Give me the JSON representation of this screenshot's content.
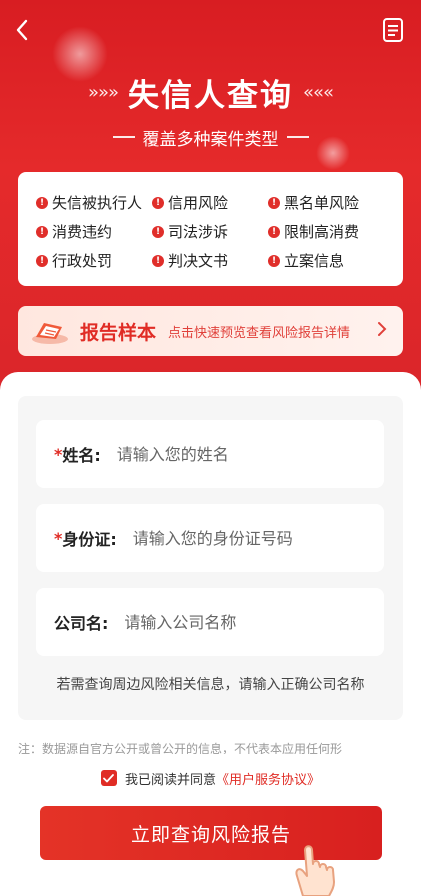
{
  "header": {
    "title": "失信人查询",
    "left_arrows": "»»»",
    "right_arrows": "«««",
    "subtitle": "覆盖多种案件类型"
  },
  "categories": [
    "失信被执行人",
    "信用风险",
    "黑名单风险",
    "消费违约",
    "司法涉诉",
    "限制高消费",
    "行政处罚",
    "判决文书",
    "立案信息"
  ],
  "sample": {
    "title": "报告样本",
    "description": "点击快速预览查看风险报告详情"
  },
  "form": {
    "name": {
      "required_mark": "*",
      "label": "姓名:",
      "placeholder": "请输入您的姓名"
    },
    "id_card": {
      "required_mark": "*",
      "label": "身份证:",
      "placeholder": "请输入您的身份证号码"
    },
    "company": {
      "label": "公司名:",
      "placeholder": "请输入公司名称"
    },
    "hint": "若需查询周边风险相关信息，请输入正确公司名称"
  },
  "disclaimer": "注：数据源自官方公开或曾公开的信息，不代表本应用任何形",
  "agreement": {
    "checked": true,
    "text": "我已阅读并同意",
    "link": "《用户服务协议》"
  },
  "cta_label": "立即查询风险报告",
  "colors": {
    "brand_red": "#e02c25",
    "hero_red": "#d81d22"
  }
}
